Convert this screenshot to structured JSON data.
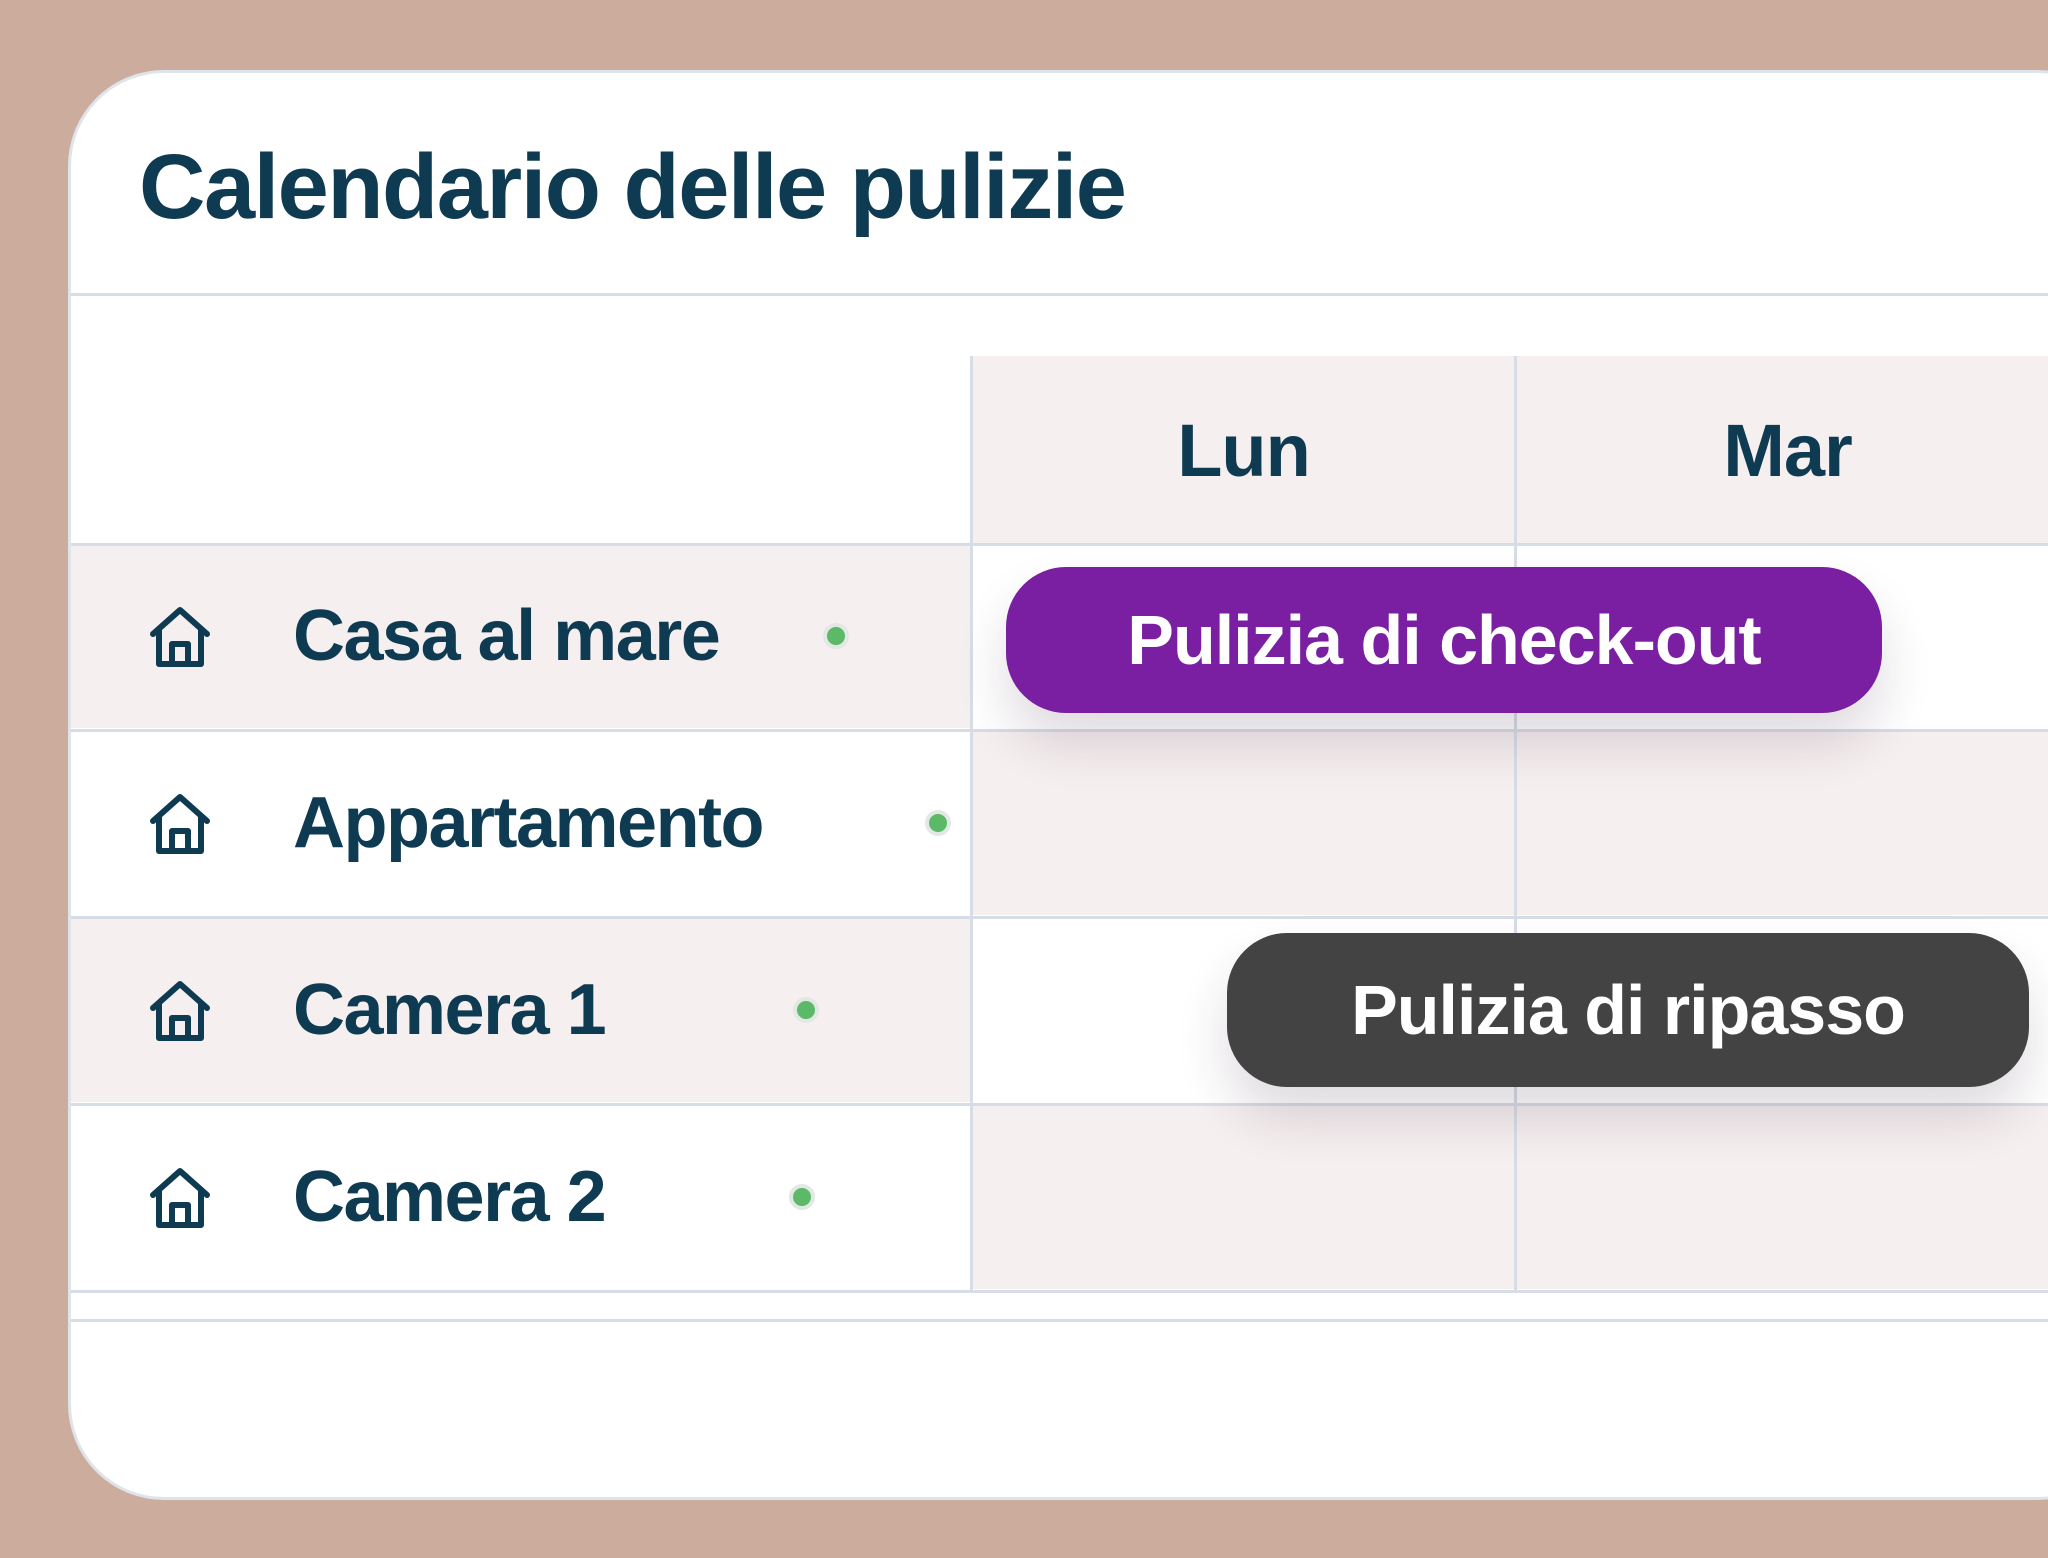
{
  "title": "Calendario delle pulizie",
  "days": [
    "Lun",
    "Mar"
  ],
  "properties": [
    {
      "name": "Casa al mare",
      "icon": "house-icon",
      "status": "active"
    },
    {
      "name": "Appartamento",
      "icon": "house-icon",
      "status": "active"
    },
    {
      "name": "Camera 1",
      "icon": "house-icon",
      "status": "active"
    },
    {
      "name": "Camera 2",
      "icon": "house-icon",
      "status": "active"
    }
  ],
  "events": [
    {
      "label": "Pulizia di check-out",
      "property": "Casa al mare",
      "color": "#7a1fa2"
    },
    {
      "label": "Pulizia di ripasso",
      "property": "Camera 1",
      "color": "#434343"
    }
  ],
  "colors": {
    "background": "#cbac9d",
    "text": "#0e3a52",
    "status_active": "#5cb968",
    "row_tint": "#f5efef"
  }
}
